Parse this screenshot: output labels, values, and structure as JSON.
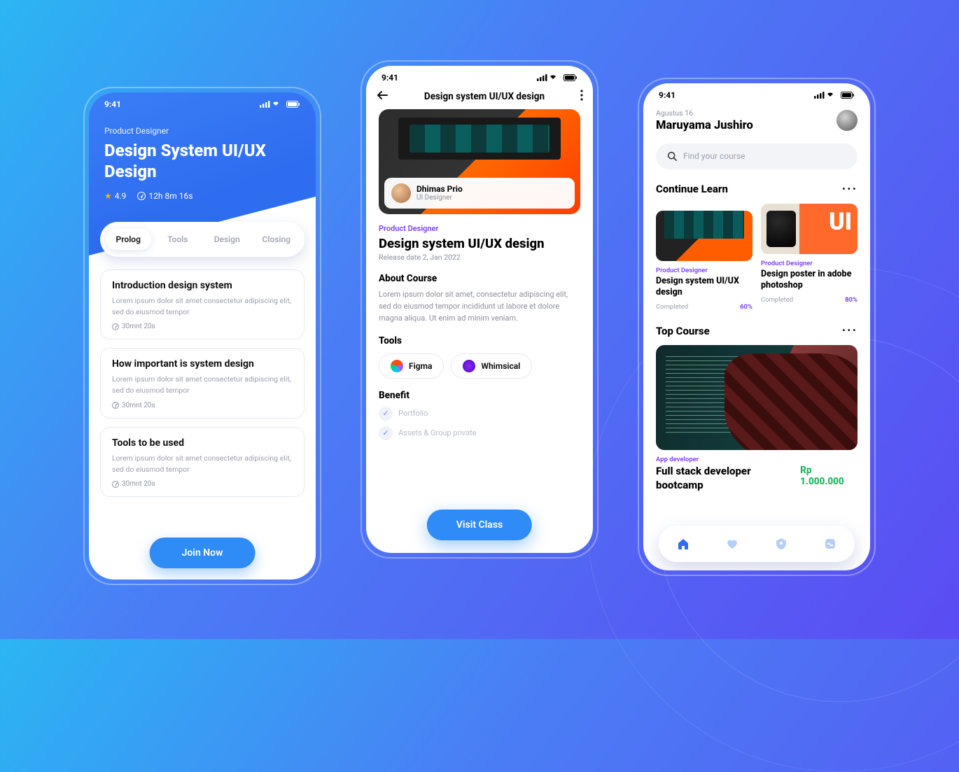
{
  "status_time": "9:41",
  "screen1": {
    "category": "Product Designer",
    "title": "Design System UI/UX Design",
    "rating": "4.9",
    "duration": "12h 8m 16s",
    "tabs": [
      "Prolog",
      "Tools",
      "Design",
      "Closing"
    ],
    "lessons": [
      {
        "title": "Introduction design system",
        "desc": "Lorem ipsum dolor sit amet consectetur adipiscing elit, sed do eiusmod tempor",
        "duration": "30mnt 20s"
      },
      {
        "title": "How important is system design",
        "desc": "Lorem ipsum dolor sit amet consectetur adipiscing elit, sed do eiusmod tempor",
        "duration": "30mnt 20s"
      },
      {
        "title": "Tools to be used",
        "desc": "Lorem ipsum dolor sit amet consectetur adipiscing elit, sed do eiusmod tempor",
        "duration": "30mnt 20s"
      }
    ],
    "cta": "Join Now"
  },
  "screen2": {
    "header_title": "Design system UI/UX design",
    "author_name": "Dhimas Prio",
    "author_role": "UI Designer",
    "category": "Product Designer",
    "title": "Design system UI/UX design",
    "release": "Release date 2, Jan 2022",
    "about_h": "About Course",
    "about": "Lorem ipsum dolor sit amet, consectetur adipiscing elit, sed do eiusmod tempor incididunt ut labore et dolore magna aliqua. Ut enim ad minim veniam.",
    "tools_h": "Tools",
    "tools": [
      "Figma",
      "Whimsical"
    ],
    "benefit_h": "Benefit",
    "benefits": [
      "Portfolio",
      "Assets & Group private"
    ],
    "cta": "Visit Class"
  },
  "screen3": {
    "date": "Agustus 16",
    "user": "Maruyama Jushiro",
    "search_placeholder": "Find your course",
    "continue_h": "Continue Learn",
    "cards": [
      {
        "category": "Product Designer",
        "title": "Design system UI/UX design",
        "status": "Completed",
        "pct": "60%"
      },
      {
        "category": "Product Designer",
        "title": "Design poster in adobe photoshop",
        "status": "Completed",
        "pct": "80%"
      }
    ],
    "top_h": "Top Course",
    "top": {
      "category": "App developer",
      "title": "Full stack developer bootcamp",
      "price": "Rp 1.000.000"
    }
  }
}
